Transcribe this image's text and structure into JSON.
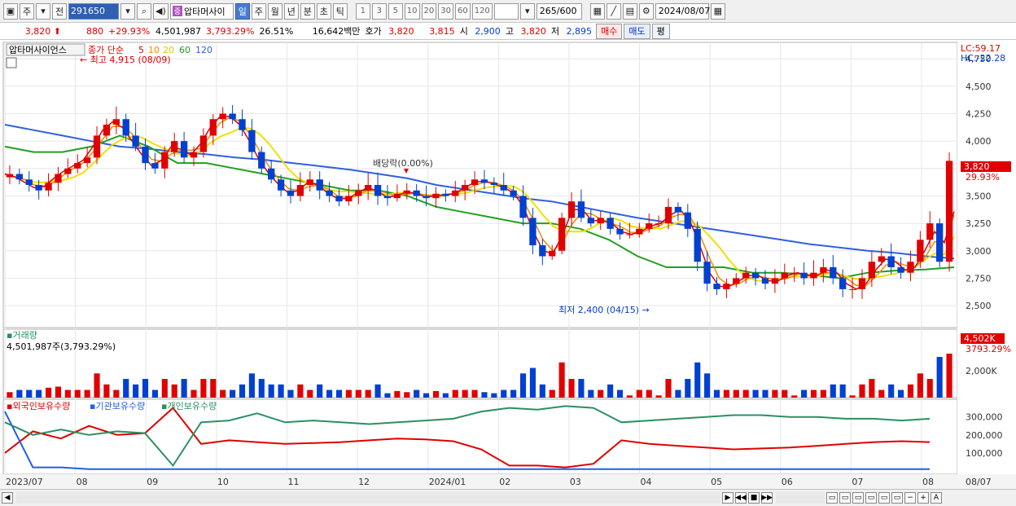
{
  "toolbar": {
    "mode_label": "주",
    "prev_label": "전",
    "code": "291650",
    "badge": "중",
    "name": "압타머사이",
    "periods": [
      "일",
      "주",
      "월",
      "년",
      "분",
      "초",
      "틱"
    ],
    "active_period": "일",
    "intervals": [
      "1",
      "3",
      "5",
      "10",
      "20",
      "30",
      "60",
      "120"
    ],
    "count": "265",
    "count_total": "/600",
    "date": "2024/08/07"
  },
  "quote": {
    "price": "3,820",
    "change": "880",
    "change_pct": "+29.93%",
    "volume": "4,501,987",
    "volume_pct": "3,793.29%",
    "turnover_pct": "26.51%",
    "amount": "16,642백만",
    "hoga_label": "호가",
    "ask": "3,820",
    "bid": "3,815",
    "open_label": "시",
    "open": "2,900",
    "high_label": "고",
    "high": "3,820",
    "low_label": "저",
    "low": "2,895",
    "buy_label": "매수",
    "sell_label": "매도",
    "avg_label": "평"
  },
  "colors": {
    "up": "#e00000",
    "down": "#0040d0",
    "ma5": "#e00000",
    "ma10": "#f08c00",
    "ma20": "#f0e000",
    "ma60": "#20a020",
    "ma120": "#3060e0",
    "foreign": "#e00000",
    "institution": "#2060e0",
    "individual": "#2a9060"
  },
  "chart_data": [
    {
      "type": "candlestick",
      "title": "압타머사이언스",
      "legend": {
        "label": "종가 단순",
        "periods": [
          "5",
          "10",
          "20",
          "60",
          "120"
        ]
      },
      "ylim": [
        2300,
        4900
      ],
      "yticks": [
        "4,750",
        "4,500",
        "4,250",
        "4,000",
        "3,750",
        "3,500",
        "3,250",
        "3,000",
        "2,750",
        "2,500"
      ],
      "ytick_values": [
        4750,
        4500,
        4250,
        4000,
        3750,
        3500,
        3250,
        3000,
        2750,
        2500
      ],
      "x_months": [
        "2023/07",
        "08",
        "09",
        "10",
        "11",
        "12",
        "2024/01",
        "02",
        "03",
        "04",
        "05",
        "06",
        "07",
        "08"
      ],
      "annotations": {
        "high": "최고 4,915 (08/09)",
        "low": "최저 2,400 (04/15)",
        "dividend": "배당락(0.00%)"
      },
      "lc_label": "LC:59.17",
      "hc_label": "HC:-22.28",
      "last_price": "3,820",
      "last_pct": "29.93%",
      "closes": [
        3700,
        3650,
        3600,
        3550,
        3620,
        3700,
        3750,
        3800,
        3850,
        4050,
        4150,
        4200,
        4050,
        3950,
        3800,
        3750,
        3900,
        4000,
        3850,
        3900,
        4050,
        4200,
        4250,
        4200,
        4100,
        3900,
        3750,
        3650,
        3550,
        3500,
        3600,
        3650,
        3550,
        3500,
        3450,
        3500,
        3550,
        3600,
        3500,
        3480,
        3520,
        3550,
        3500,
        3480,
        3520,
        3500,
        3550,
        3600,
        3650,
        3620,
        3600,
        3550,
        3500,
        3300,
        3050,
        2950,
        3000,
        3300,
        3450,
        3300,
        3250,
        3300,
        3200,
        3150,
        3150,
        3200,
        3250,
        3250,
        3400,
        3350,
        3200,
        2900,
        2700,
        2650,
        2700,
        2750,
        2800,
        2750,
        2700,
        2750,
        2800,
        2800,
        2750,
        2800,
        2850,
        2750,
        2650,
        2650,
        2750,
        2900,
        2950,
        2850,
        2800,
        2900,
        3100,
        3250,
        2900,
        3820
      ],
      "ma120": [
        4150,
        4100,
        4050,
        4000,
        3950,
        3930,
        3900,
        3880,
        3850,
        3830,
        3800,
        3770,
        3740,
        3700,
        3660,
        3600,
        3560,
        3520,
        3480,
        3450,
        3400,
        3350,
        3300,
        3260,
        3220,
        3180,
        3140,
        3100,
        3060,
        3030,
        3000,
        2980,
        2950,
        2930
      ],
      "ma60": [
        3950,
        3900,
        3900,
        3950,
        4050,
        3950,
        3800,
        3800,
        3750,
        3700,
        3650,
        3600,
        3550,
        3550,
        3500,
        3400,
        3350,
        3300,
        3250,
        3250,
        3200,
        3100,
        2950,
        2850,
        2850,
        2850,
        2800,
        2800,
        2780,
        2750,
        2800,
        2820,
        2830,
        2850
      ]
    },
    {
      "type": "bar",
      "title": "거래량",
      "value_label": "4,501,987주(3,793.29%)",
      "ytick": "2,000K",
      "last_label": "4,502K",
      "last_pct": "3793.29%"
    },
    {
      "type": "line",
      "title": "외국인보유수량",
      "series": [
        {
          "name": "외국인보유수량",
          "values": [
            100,
            220,
            180,
            250,
            200,
            210,
            350,
            150,
            170,
            160,
            150,
            155,
            160,
            170,
            180,
            175,
            165,
            120,
            30,
            30,
            20,
            40,
            170,
            150,
            140,
            130,
            120,
            125,
            130,
            140,
            150,
            160,
            165,
            160
          ]
        },
        {
          "name": "기관보유수량",
          "values": [
            330,
            20,
            20,
            10,
            10,
            10,
            10,
            10,
            10,
            10,
            10,
            10,
            10,
            10,
            10,
            10,
            10,
            10,
            10,
            10,
            10,
            10,
            10,
            10,
            10,
            10,
            10,
            10,
            10,
            10,
            10,
            10,
            10,
            10
          ]
        },
        {
          "name": "개인보유수량",
          "values": [
            270,
            200,
            230,
            200,
            220,
            210,
            30,
            270,
            280,
            320,
            270,
            280,
            270,
            260,
            270,
            280,
            290,
            330,
            350,
            340,
            360,
            350,
            270,
            280,
            290,
            300,
            310,
            310,
            300,
            300,
            290,
            290,
            280,
            290
          ]
        }
      ],
      "yticks": [
        "300,000",
        "200,000",
        "100,000"
      ],
      "ytick_values": [
        300,
        200,
        100
      ]
    }
  ]
}
